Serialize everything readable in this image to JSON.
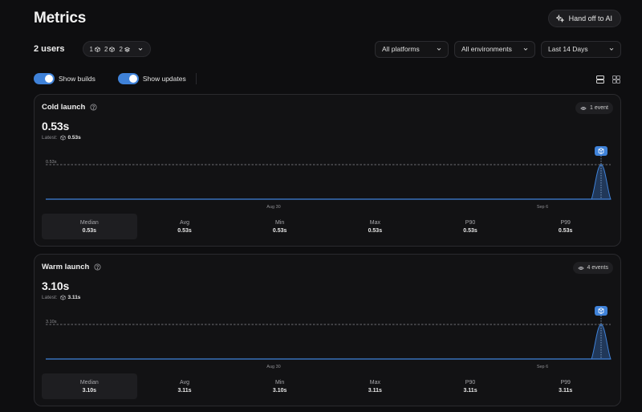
{
  "header": {
    "title": "Metrics",
    "handoff_label": "Hand off to AI",
    "handoff_icon": "sparkle-icon"
  },
  "filters": {
    "users_label": "2 users",
    "counts": [
      {
        "count": "1",
        "icon": "box-icon"
      },
      {
        "count": "2",
        "icon": "box-icon"
      },
      {
        "count": "2",
        "icon": "layers-icon"
      }
    ],
    "platforms": "All platforms",
    "environments": "All environments",
    "range": "Last 14 Days"
  },
  "toggles": {
    "show_builds": {
      "label": "Show builds",
      "on": true
    },
    "show_updates": {
      "label": "Show updates",
      "on": true
    }
  },
  "colors": {
    "accent": "#3f82d9",
    "background": "#0e0e10",
    "card": "#121214"
  },
  "cards": [
    {
      "title": "Cold launch",
      "events": "1 event",
      "value": "0.53s",
      "latest_label": "Latest:",
      "latest_value": "0.53s",
      "stats": [
        {
          "label": "Median",
          "value": "0.53s"
        },
        {
          "label": "Avg",
          "value": "0.53s"
        },
        {
          "label": "Min",
          "value": "0.53s"
        },
        {
          "label": "Max",
          "value": "0.53s"
        },
        {
          "label": "P90",
          "value": "0.53s"
        },
        {
          "label": "P99",
          "value": "0.53s"
        }
      ]
    },
    {
      "title": "Warm launch",
      "events": "4 events",
      "value": "3.10s",
      "latest_label": "Latest:",
      "latest_value": "3.11s",
      "stats": [
        {
          "label": "Median",
          "value": "3.10s"
        },
        {
          "label": "Avg",
          "value": "3.11s"
        },
        {
          "label": "Min",
          "value": "3.10s"
        },
        {
          "label": "Max",
          "value": "3.11s"
        },
        {
          "label": "P90",
          "value": "3.11s"
        },
        {
          "label": "P99",
          "value": "3.11s"
        }
      ]
    }
  ],
  "chart_data": [
    {
      "type": "area",
      "x_ticks": [
        "Aug 30",
        "Sep 6"
      ],
      "reference_line": {
        "label": "0.53s",
        "value": 0.53
      },
      "peak": {
        "x": "latest",
        "y": 0.53,
        "marker": "box-icon"
      }
    },
    {
      "type": "area",
      "x_ticks": [
        "Aug 30",
        "Sep 6"
      ],
      "reference_line": {
        "label": "3.10s",
        "value": 3.1
      },
      "peak": {
        "x": "latest",
        "y": 3.1,
        "marker": "box-icon"
      }
    }
  ]
}
